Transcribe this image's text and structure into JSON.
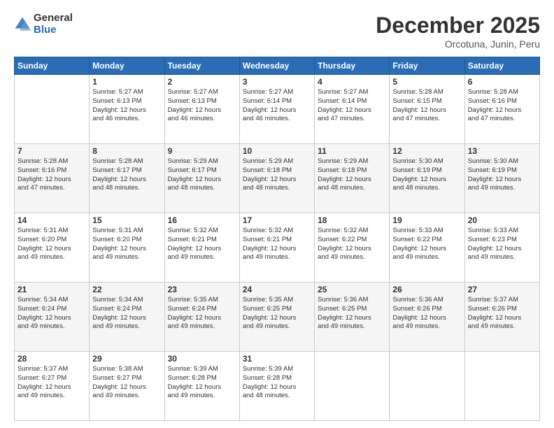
{
  "logo": {
    "general": "General",
    "blue": "Blue"
  },
  "header": {
    "month": "December 2025",
    "location": "Orcotuna, Junin, Peru"
  },
  "days_of_week": [
    "Sunday",
    "Monday",
    "Tuesday",
    "Wednesday",
    "Thursday",
    "Friday",
    "Saturday"
  ],
  "weeks": [
    [
      {
        "day": "",
        "sunrise": "",
        "sunset": "",
        "daylight": ""
      },
      {
        "day": "1",
        "sunrise": "Sunrise: 5:27 AM",
        "sunset": "Sunset: 6:13 PM",
        "daylight": "Daylight: 12 hours and 46 minutes."
      },
      {
        "day": "2",
        "sunrise": "Sunrise: 5:27 AM",
        "sunset": "Sunset: 6:13 PM",
        "daylight": "Daylight: 12 hours and 46 minutes."
      },
      {
        "day": "3",
        "sunrise": "Sunrise: 5:27 AM",
        "sunset": "Sunset: 6:14 PM",
        "daylight": "Daylight: 12 hours and 46 minutes."
      },
      {
        "day": "4",
        "sunrise": "Sunrise: 5:27 AM",
        "sunset": "Sunset: 6:14 PM",
        "daylight": "Daylight: 12 hours and 47 minutes."
      },
      {
        "day": "5",
        "sunrise": "Sunrise: 5:28 AM",
        "sunset": "Sunset: 6:15 PM",
        "daylight": "Daylight: 12 hours and 47 minutes."
      },
      {
        "day": "6",
        "sunrise": "Sunrise: 5:28 AM",
        "sunset": "Sunset: 6:16 PM",
        "daylight": "Daylight: 12 hours and 47 minutes."
      }
    ],
    [
      {
        "day": "7",
        "sunrise": "Sunrise: 5:28 AM",
        "sunset": "Sunset: 6:16 PM",
        "daylight": "Daylight: 12 hours and 47 minutes."
      },
      {
        "day": "8",
        "sunrise": "Sunrise: 5:28 AM",
        "sunset": "Sunset: 6:17 PM",
        "daylight": "Daylight: 12 hours and 48 minutes."
      },
      {
        "day": "9",
        "sunrise": "Sunrise: 5:29 AM",
        "sunset": "Sunset: 6:17 PM",
        "daylight": "Daylight: 12 hours and 48 minutes."
      },
      {
        "day": "10",
        "sunrise": "Sunrise: 5:29 AM",
        "sunset": "Sunset: 6:18 PM",
        "daylight": "Daylight: 12 hours and 48 minutes."
      },
      {
        "day": "11",
        "sunrise": "Sunrise: 5:29 AM",
        "sunset": "Sunset: 6:18 PM",
        "daylight": "Daylight: 12 hours and 48 minutes."
      },
      {
        "day": "12",
        "sunrise": "Sunrise: 5:30 AM",
        "sunset": "Sunset: 6:19 PM",
        "daylight": "Daylight: 12 hours and 48 minutes."
      },
      {
        "day": "13",
        "sunrise": "Sunrise: 5:30 AM",
        "sunset": "Sunset: 6:19 PM",
        "daylight": "Daylight: 12 hours and 49 minutes."
      }
    ],
    [
      {
        "day": "14",
        "sunrise": "Sunrise: 5:31 AM",
        "sunset": "Sunset: 6:20 PM",
        "daylight": "Daylight: 12 hours and 49 minutes."
      },
      {
        "day": "15",
        "sunrise": "Sunrise: 5:31 AM",
        "sunset": "Sunset: 6:20 PM",
        "daylight": "Daylight: 12 hours and 49 minutes."
      },
      {
        "day": "16",
        "sunrise": "Sunrise: 5:32 AM",
        "sunset": "Sunset: 6:21 PM",
        "daylight": "Daylight: 12 hours and 49 minutes."
      },
      {
        "day": "17",
        "sunrise": "Sunrise: 5:32 AM",
        "sunset": "Sunset: 6:21 PM",
        "daylight": "Daylight: 12 hours and 49 minutes."
      },
      {
        "day": "18",
        "sunrise": "Sunrise: 5:32 AM",
        "sunset": "Sunset: 6:22 PM",
        "daylight": "Daylight: 12 hours and 49 minutes."
      },
      {
        "day": "19",
        "sunrise": "Sunrise: 5:33 AM",
        "sunset": "Sunset: 6:22 PM",
        "daylight": "Daylight: 12 hours and 49 minutes."
      },
      {
        "day": "20",
        "sunrise": "Sunrise: 5:33 AM",
        "sunset": "Sunset: 6:23 PM",
        "daylight": "Daylight: 12 hours and 49 minutes."
      }
    ],
    [
      {
        "day": "21",
        "sunrise": "Sunrise: 5:34 AM",
        "sunset": "Sunset: 6:24 PM",
        "daylight": "Daylight: 12 hours and 49 minutes."
      },
      {
        "day": "22",
        "sunrise": "Sunrise: 5:34 AM",
        "sunset": "Sunset: 6:24 PM",
        "daylight": "Daylight: 12 hours and 49 minutes."
      },
      {
        "day": "23",
        "sunrise": "Sunrise: 5:35 AM",
        "sunset": "Sunset: 6:24 PM",
        "daylight": "Daylight: 12 hours and 49 minutes."
      },
      {
        "day": "24",
        "sunrise": "Sunrise: 5:35 AM",
        "sunset": "Sunset: 6:25 PM",
        "daylight": "Daylight: 12 hours and 49 minutes."
      },
      {
        "day": "25",
        "sunrise": "Sunrise: 5:36 AM",
        "sunset": "Sunset: 6:25 PM",
        "daylight": "Daylight: 12 hours and 49 minutes."
      },
      {
        "day": "26",
        "sunrise": "Sunrise: 5:36 AM",
        "sunset": "Sunset: 6:26 PM",
        "daylight": "Daylight: 12 hours and 49 minutes."
      },
      {
        "day": "27",
        "sunrise": "Sunrise: 5:37 AM",
        "sunset": "Sunset: 6:26 PM",
        "daylight": "Daylight: 12 hours and 49 minutes."
      }
    ],
    [
      {
        "day": "28",
        "sunrise": "Sunrise: 5:37 AM",
        "sunset": "Sunset: 6:27 PM",
        "daylight": "Daylight: 12 hours and 49 minutes."
      },
      {
        "day": "29",
        "sunrise": "Sunrise: 5:38 AM",
        "sunset": "Sunset: 6:27 PM",
        "daylight": "Daylight: 12 hours and 49 minutes."
      },
      {
        "day": "30",
        "sunrise": "Sunrise: 5:39 AM",
        "sunset": "Sunset: 6:28 PM",
        "daylight": "Daylight: 12 hours and 49 minutes."
      },
      {
        "day": "31",
        "sunrise": "Sunrise: 5:39 AM",
        "sunset": "Sunset: 6:28 PM",
        "daylight": "Daylight: 12 hours and 48 minutes."
      },
      {
        "day": "",
        "sunrise": "",
        "sunset": "",
        "daylight": ""
      },
      {
        "day": "",
        "sunrise": "",
        "sunset": "",
        "daylight": ""
      },
      {
        "day": "",
        "sunrise": "",
        "sunset": "",
        "daylight": ""
      }
    ]
  ]
}
